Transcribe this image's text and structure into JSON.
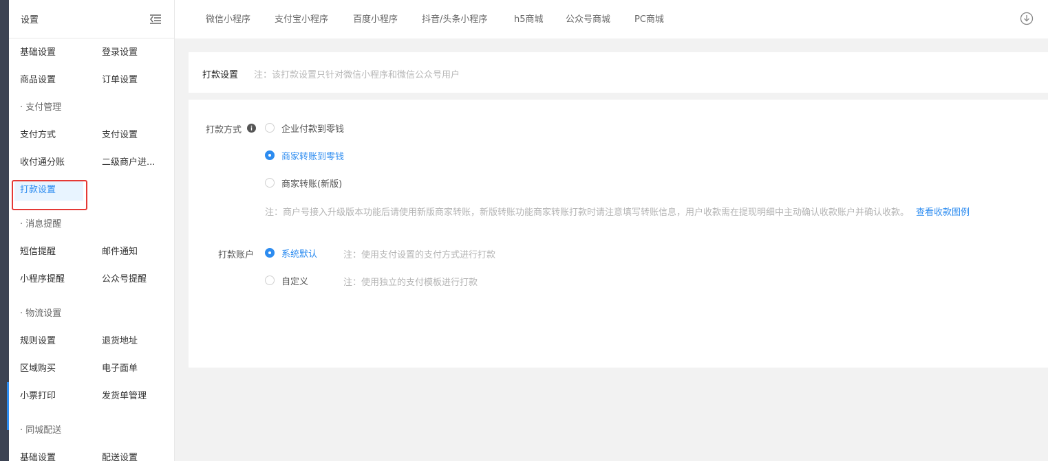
{
  "sidebar": {
    "title": "设置",
    "rows": [
      {
        "c1": "基础设置",
        "c2": "登录设置"
      },
      {
        "c1": "商品设置",
        "c2": "订单设置"
      },
      {
        "group": "· 支付管理"
      },
      {
        "c1": "支付方式",
        "c2": "支付设置"
      },
      {
        "c1": "收付通分账",
        "c2": "二级商户进..."
      },
      {
        "c1": "打款设置",
        "c2": ""
      },
      {
        "group": "· 消息提醒"
      },
      {
        "c1": "短信提醒",
        "c2": "邮件通知"
      },
      {
        "c1": "小程序提醒",
        "c2": "公众号提醒"
      },
      {
        "group": "· 物流设置"
      },
      {
        "c1": "规则设置",
        "c2": "退货地址"
      },
      {
        "c1": "区域购买",
        "c2": "电子面单"
      },
      {
        "c1": "小票打印",
        "c2": "发货单管理"
      },
      {
        "group": "· 同城配送"
      },
      {
        "c1": "基础设置",
        "c2": "配送设置"
      }
    ]
  },
  "topnav": {
    "tabs": [
      "微信小程序",
      "支付宝小程序",
      "百度小程序",
      "抖音/头条小程序",
      "h5商城",
      "公众号商城",
      "PC商城"
    ]
  },
  "header": {
    "title": "打款设置",
    "note": "注：该打款设置只针对微信小程序和微信公众号用户"
  },
  "form": {
    "method_label": "打款方式",
    "method_options": [
      "企业付款到零钱",
      "商家转账到零钱",
      "商家转账(新版)"
    ],
    "method_selected": 1,
    "method_note": "注：商户号接入升级版本功能后请使用新版商家转账，新版转账功能商家转账打款时请注意填写转账信息，用户收款需在提现明细中主动确认收款账户并确认收款。",
    "method_link": "查看收款图例",
    "account_label": "打款账户",
    "account_options": [
      "系统默认",
      "自定义"
    ],
    "account_selected": 0,
    "account_notes": [
      "注：使用支付设置的支付方式进行打款",
      "注：使用独立的支付模板进行打款"
    ]
  },
  "colors": {
    "accent": "#2d8cf0",
    "highlight": "#e53935",
    "strip": "#3c4353"
  },
  "icons": {
    "menu": "menu-fold-icon",
    "download": "download-circle-icon",
    "info": "info-icon"
  }
}
